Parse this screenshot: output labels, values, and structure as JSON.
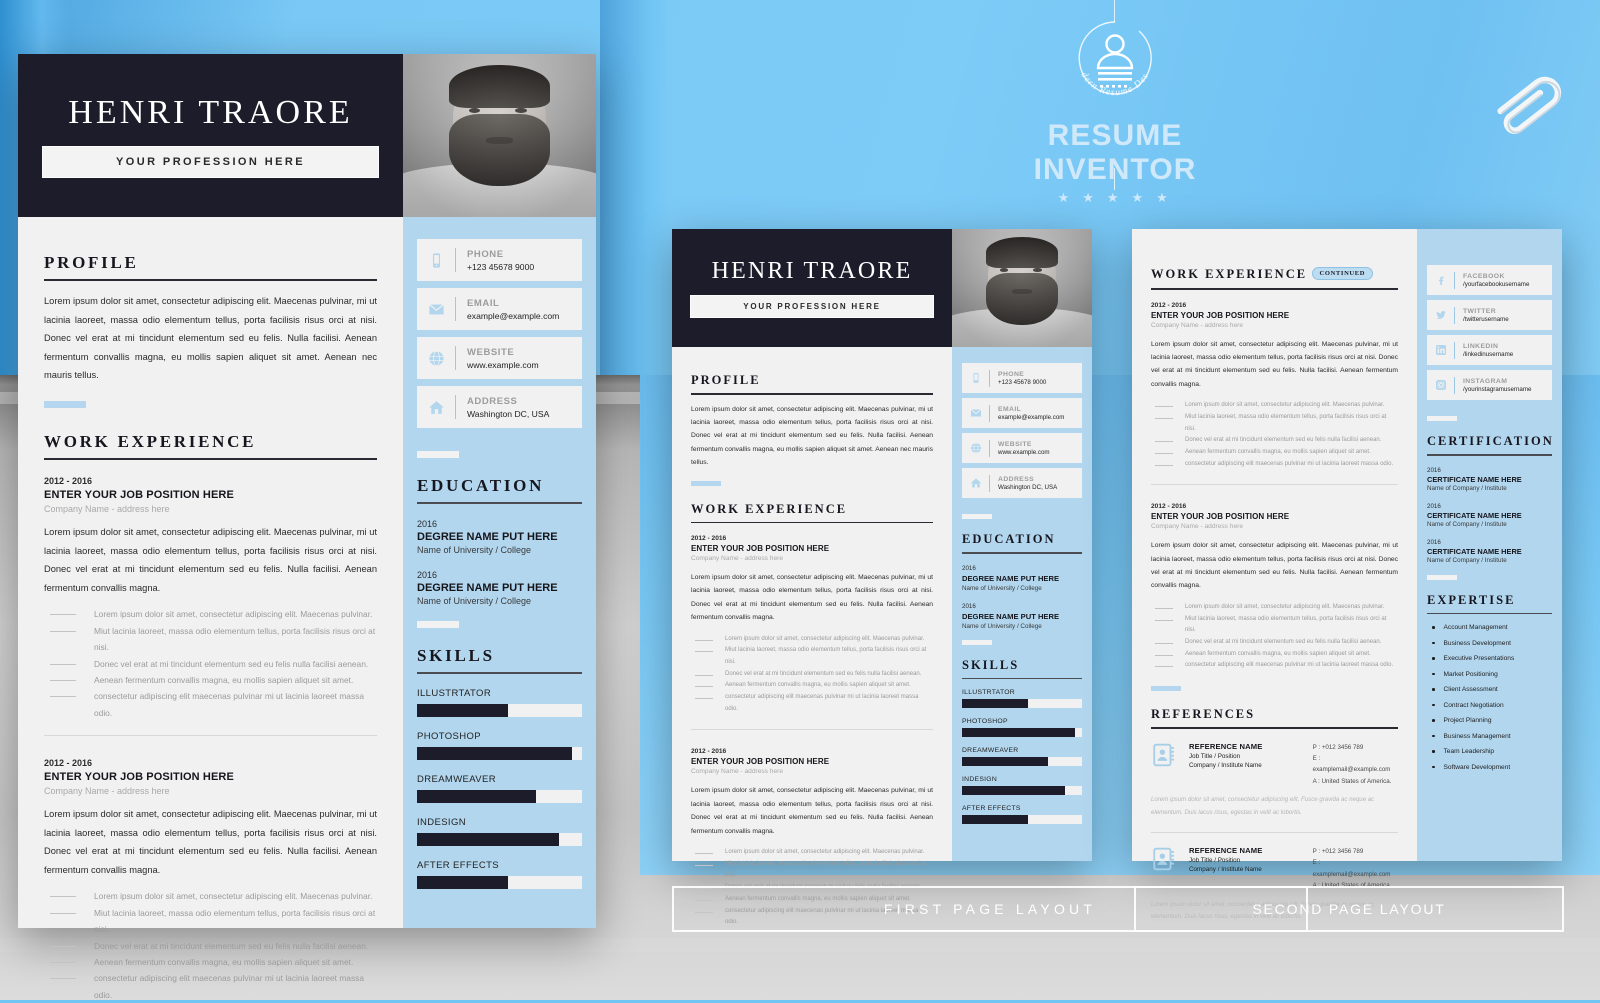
{
  "brand": {
    "logo_title": "RESUME INVENTOR",
    "logo_tagline": "Modern Resume Design",
    "stars": "★ ★ ★ ★ ★",
    "accent_blue": "#7AC8F5",
    "sidebar_blue": "#B2D6EE",
    "dark": "#1D1C2B"
  },
  "labels": {
    "first_page": "FIRST PAGE LAYOUT",
    "second_page": "SECOND PAGE LAYOUT"
  },
  "header": {
    "name": "HENRI TRAORE",
    "profession": "YOUR PROFESSION HERE"
  },
  "profile": {
    "heading": "PROFILE",
    "text": "Lorem ipsum dolor sit amet, consectetur adipiscing elit. Maecenas pulvinar, mi ut lacinia laoreet, massa odio elementum tellus, porta facilisis risus orci at nisi. Donec vel erat at mi tincidunt elementum sed eu felis. Nulla facilisi. Aenean fermentum convallis magna, eu mollis sapien aliquet sit amet. Aenean nec mauris tellus."
  },
  "work": {
    "heading": "WORK EXPERIENCE",
    "continued_badge": "CONTINUED",
    "jobs": [
      {
        "date": "2012 - 2016",
        "title": "ENTER YOUR JOB POSITION HERE",
        "company": "Company Name - address here",
        "summary": "Lorem ipsum dolor sit amet, consectetur adipiscing elit. Maecenas pulvinar, mi ut lacinia laoreet, massa odio elementum tellus, porta facilisis risus orci at nisi. Donec vel erat at mi tincidunt elementum sed eu felis. Nulla facilisi. Aenean fermentum convallis magna.",
        "bullets": [
          "Lorem ipsum dolor sit amet, consectetur adipiscing elit. Maecenas pulvinar.",
          "Miut lacinia laoreet, massa odio elementum tellus, porta facilisis risus orci at nisi.",
          "Donec vel erat at mi tincidunt elementum sed eu felis nulla facilisi aenean.",
          "Aenean fermentum convallis magna, eu mollis sapien aliquet sit amet.",
          "consectetur adipiscing elit maecenas pulvinar mi ut lacinia laoreet massa odio."
        ]
      },
      {
        "date": "2012 - 2016",
        "title": "ENTER YOUR JOB POSITION HERE",
        "company": "Company Name - address here",
        "summary": "Lorem ipsum dolor sit amet, consectetur adipiscing elit. Maecenas pulvinar, mi ut lacinia laoreet, massa odio elementum tellus, porta facilisis risus orci at nisi. Donec vel erat at mi tincidunt elementum sed eu felis. Nulla facilisi. Aenean fermentum convallis magna.",
        "bullets": [
          "Lorem ipsum dolor sit amet, consectetur adipiscing elit. Maecenas pulvinar.",
          "Miut lacinia laoreet, massa odio elementum tellus, porta facilisis risus orci at nisi.",
          "Donec vel erat at mi tincidunt elementum sed eu felis nulla facilisi aenean.",
          "Aenean fermentum convallis magna, eu mollis sapien aliquet sit amet.",
          "consectetur adipiscing elit maecenas pulvinar mi ut lacinia laoreet massa odio."
        ]
      }
    ]
  },
  "contact": {
    "items": [
      {
        "icon": "phone-icon",
        "label": "PHONE",
        "value": "+123 45678 9000"
      },
      {
        "icon": "email-icon",
        "label": "EMAIL",
        "value": "example@example.com"
      },
      {
        "icon": "website-icon",
        "label": "WEBSITE",
        "value": "www.example.com"
      },
      {
        "icon": "address-icon",
        "label": "ADDRESS",
        "value": "Washington DC, USA"
      }
    ]
  },
  "education": {
    "heading": "EDUCATION",
    "items": [
      {
        "year": "2016",
        "degree": "DEGREE NAME PUT HERE",
        "school": "Name of University / College"
      },
      {
        "year": "2016",
        "degree": "DEGREE NAME PUT HERE",
        "school": "Name of University / College"
      }
    ]
  },
  "skills": {
    "heading": "SKILLS",
    "items": [
      {
        "name": "ILLUSTRTATOR",
        "percent": 55
      },
      {
        "name": "PHOTOSHOP",
        "percent": 94
      },
      {
        "name": "DREAMWEAVER",
        "percent": 72
      },
      {
        "name": "INDESIGN",
        "percent": 86
      },
      {
        "name": "AFTER EFFECTS",
        "percent": 55
      }
    ]
  },
  "social": {
    "items": [
      {
        "icon": "facebook-icon",
        "label": "FACEBOOK",
        "value": "/yourfacebookusername"
      },
      {
        "icon": "twitter-icon",
        "label": "TWITTER",
        "value": "/twitterusername"
      },
      {
        "icon": "linkedin-icon",
        "label": "LINKEDIN",
        "value": "/linkedinusername"
      },
      {
        "icon": "instagram-icon",
        "label": "INSTAGRAM",
        "value": "/yourinstagramusername"
      }
    ]
  },
  "certification": {
    "heading": "CERTIFICATION",
    "items": [
      {
        "year": "2016",
        "name": "CERTIFICATE NAME HERE",
        "company": "Name of Company / Institute"
      },
      {
        "year": "2016",
        "name": "CERTIFICATE NAME HERE",
        "company": "Name of Company / Institute"
      },
      {
        "year": "2016",
        "name": "CERTIFICATE NAME HERE",
        "company": "Name of Company / Institute"
      }
    ]
  },
  "expertise": {
    "heading": "EXPERTISE",
    "items": [
      "Account Management",
      "Business Development",
      "Executive Presentations",
      "Market Positioning",
      "Client Assessment",
      "Contract Negotiation",
      "Project Planning",
      "Business Management",
      "Team Leadership",
      "Software Development"
    ]
  },
  "references": {
    "heading": "REFERENCES",
    "items": [
      {
        "name": "REFERENCE NAME",
        "job": "Job Title / Position",
        "company": "Company / Institute Name",
        "phone": "P : +012 3456 789",
        "email": "E : examplemail@example.com",
        "address": "A : United States of America.",
        "note": "Lorem ipsum dolor sit amet, consectetur adipiscing elit. Fusce gravida ac neque ac elementum. Duis lacus risus, egestas in velit ac lobortis."
      },
      {
        "name": "REFERENCE NAME",
        "job": "Job Title / Position",
        "company": "Company / Institute Name",
        "phone": "P : +012 3456 789",
        "email": "E : examplemail@example.com",
        "address": "A : United States of America.",
        "note": "Lorem ipsum dolor sit amet, consectetur adipiscing elit. Fusce gravida ac neque ac elementum. Duis lacus risus, egestas in velit ac lobortis."
      }
    ]
  }
}
